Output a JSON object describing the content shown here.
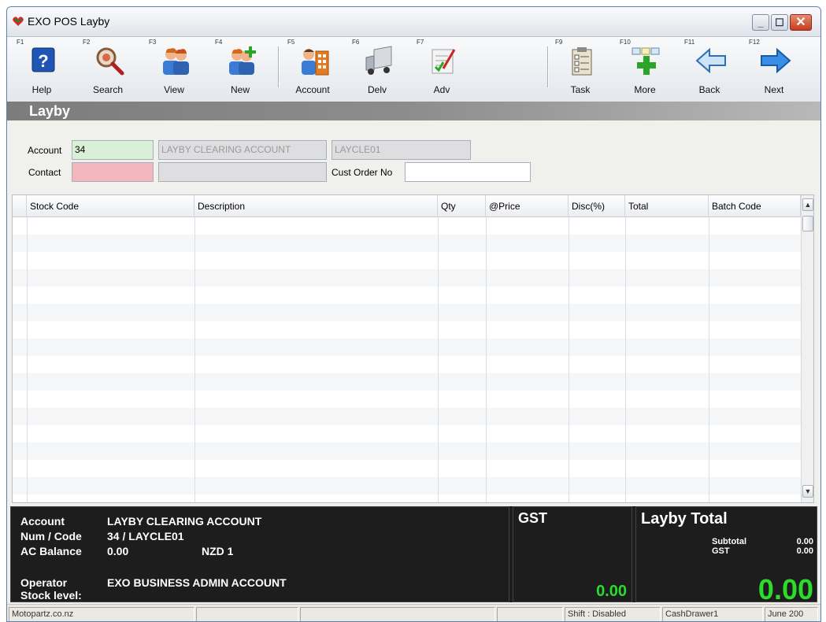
{
  "window": {
    "title": "EXO POS Layby"
  },
  "toolbar": {
    "buttons": [
      {
        "key": "F1",
        "label": "Help",
        "icon": "help-icon"
      },
      {
        "key": "F2",
        "label": "Search",
        "icon": "search-icon"
      },
      {
        "key": "F3",
        "label": "View",
        "icon": "view-people-icon"
      },
      {
        "key": "F4",
        "label": "New",
        "icon": "new-person-icon"
      },
      {
        "key": "F5",
        "label": "Account",
        "icon": "account-icon"
      },
      {
        "key": "F6",
        "label": "Delv",
        "icon": "delivery-truck-icon"
      },
      {
        "key": "F7",
        "label": "Adv",
        "icon": "advanced-edit-icon"
      },
      {
        "key": "F9",
        "label": "Task",
        "icon": "task-clipboard-icon"
      },
      {
        "key": "F10",
        "label": "More",
        "icon": "more-add-icon"
      },
      {
        "key": "F11",
        "label": "Back",
        "icon": "back-arrow-icon"
      },
      {
        "key": "F12",
        "label": "Next",
        "icon": "next-arrow-icon"
      }
    ]
  },
  "module": {
    "title": "Layby"
  },
  "form": {
    "account_label": "Account",
    "account_value": "34",
    "account_name": "LAYBY CLEARING ACCOUNT",
    "account_code": "LAYCLE01",
    "contact_label": "Contact",
    "contact_value": "",
    "contact_name": "",
    "cust_order_label": "Cust Order No",
    "cust_order_value": ""
  },
  "grid": {
    "columns": [
      "Stock Code",
      "Description",
      "Qty",
      "@Price",
      "Disc(%)",
      "Total",
      "Batch Code"
    ],
    "rows": []
  },
  "info": {
    "account_label": "Account",
    "account_value": "LAYBY CLEARING ACCOUNT",
    "num_code_label": "Num / Code",
    "num_code_value": "34 / LAYCLE01",
    "ac_balance_label": "AC Balance",
    "ac_balance_value": "0.00",
    "currency": "NZD 1",
    "operator_label": "Operator",
    "operator_value": "EXO BUSINESS ADMIN ACCOUNT",
    "stock_level_label": "Stock level:",
    "gst_title": "GST",
    "gst_value": "0.00",
    "total_title": "Layby Total",
    "subtotal_label": "Subtotal",
    "subtotal_value": "0.00",
    "gst_label": "GST",
    "gst_sub_value": "0.00",
    "total_value": "0.00"
  },
  "statusbar": {
    "site": "Motopartz.co.nz",
    "shift": "Shift : Disabled",
    "drawer": "CashDrawer1",
    "date": "June 200"
  },
  "colors": {
    "accent_green": "#2bdc2b",
    "account_field": "#d9efd6",
    "contact_field": "#f4b6bd",
    "info_panel": "#1d1d1d"
  }
}
